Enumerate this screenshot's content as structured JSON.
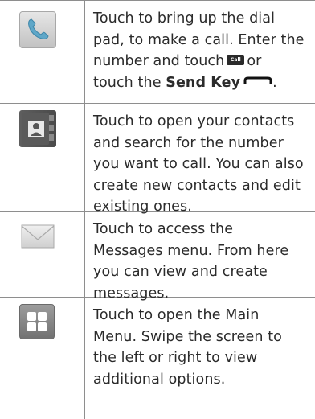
{
  "rows": [
    {
      "icon": "phone-icon",
      "text_part1": "Touch to bring up the dial pad, to make a call. Enter the number and touch",
      "badge_text": "Call",
      "text_part2": "or touch the",
      "bold_text": "Send Key",
      "text_part3": "."
    },
    {
      "icon": "contacts-icon",
      "text": "Touch to open your contacts and search for the number you want to call. You can also create new contacts and edit existing ones."
    },
    {
      "icon": "envelope-icon",
      "text": "Touch to access the Messages menu. From here you can view and create messages."
    },
    {
      "icon": "grid-menu-icon",
      "text": "Touch to open the Main Menu. Swipe the screen to the left or right to view additional options."
    }
  ],
  "colors": {
    "rule": "#8e8e8e",
    "text": "#2b2b2b"
  }
}
